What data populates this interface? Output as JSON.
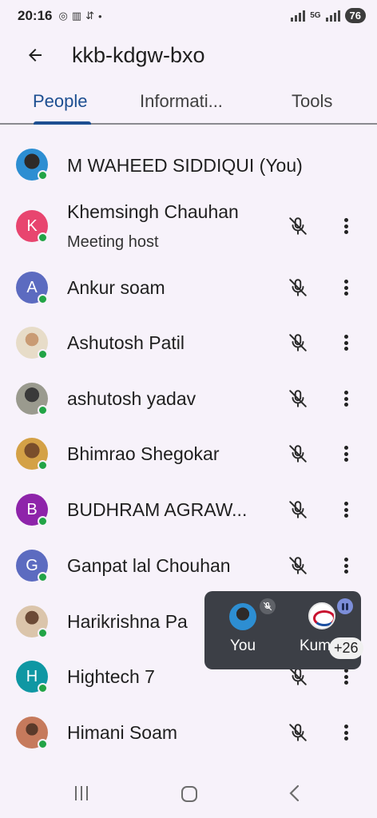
{
  "status_bar": {
    "time": "20:16",
    "left_icons": [
      "whatsapp-icon",
      "sim-icon",
      "usb-icon",
      "dot-icon"
    ],
    "network_tag": "5G",
    "battery": "76"
  },
  "app_bar": {
    "title": "kkb-kdgw-bxo"
  },
  "tabs": [
    {
      "label": "People",
      "active": true
    },
    {
      "label": "Informati...",
      "active": false
    },
    {
      "label": "Tools",
      "active": false
    }
  ],
  "participants": [
    {
      "name": "M WAHEED SIDDIQUI (You)",
      "subtitle": "",
      "avatar_letter": "",
      "avatar_color": "",
      "is_self": true
    },
    {
      "name": "Khemsingh Chauhan",
      "subtitle": "Meeting host",
      "avatar_letter": "K",
      "avatar_color": "#e8456f",
      "is_self": false
    },
    {
      "name": "Ankur soam",
      "subtitle": "",
      "avatar_letter": "A",
      "avatar_color": "#5c6bc0",
      "is_self": false
    },
    {
      "name": "Ashutosh Patil",
      "subtitle": "",
      "avatar_letter": "",
      "avatar_color": "",
      "is_self": false
    },
    {
      "name": "ashutosh yadav",
      "subtitle": "",
      "avatar_letter": "",
      "avatar_color": "",
      "is_self": false
    },
    {
      "name": "Bhimrao Shegokar",
      "subtitle": "",
      "avatar_letter": "",
      "avatar_color": "",
      "is_self": false
    },
    {
      "name": "BUDHRAM AGRAW...",
      "subtitle": "",
      "avatar_letter": "B",
      "avatar_color": "#8e24aa",
      "is_self": false
    },
    {
      "name": "Ganpat lal Chouhan",
      "subtitle": "",
      "avatar_letter": "G",
      "avatar_color": "#5c6bc0",
      "is_self": false
    },
    {
      "name": "Harikrishna Pa",
      "subtitle": "",
      "avatar_letter": "",
      "avatar_color": "",
      "is_self": false
    },
    {
      "name": "Hightech 7",
      "subtitle": "",
      "avatar_letter": "H",
      "avatar_color": "#0f97a3",
      "is_self": false
    },
    {
      "name": "Himani Soam",
      "subtitle": "",
      "avatar_letter": "",
      "avatar_color": "",
      "is_self": false
    }
  ],
  "floating_panel": {
    "self_label": "You",
    "other_label": "Kum",
    "more_count": "+26"
  },
  "colors": {
    "accent": "#1d4f91",
    "online": "#22a446",
    "background": "#f7f2fa",
    "panel": "#3c3f46"
  }
}
